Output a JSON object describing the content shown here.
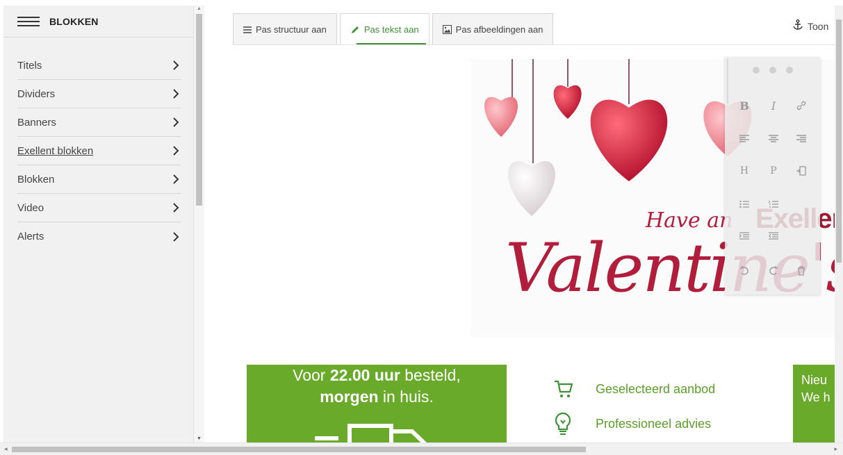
{
  "sidebar": {
    "title": "BLOKKEN",
    "items": [
      {
        "label": "Titels"
      },
      {
        "label": "Dividers"
      },
      {
        "label": "Banners"
      },
      {
        "label": "Exellent blokken"
      },
      {
        "label": "Blokken"
      },
      {
        "label": "Video"
      },
      {
        "label": "Alerts"
      }
    ]
  },
  "tabs": [
    {
      "label": "Pas structuur aan",
      "icon": "list-icon"
    },
    {
      "label": "Pas tekst aan",
      "icon": "pencil-icon",
      "active": true
    },
    {
      "label": "Pas afbeeldingen aan",
      "icon": "image-icon"
    }
  ],
  "toon": {
    "label": "Toon",
    "icon": "anchor-icon"
  },
  "banner": {
    "have": "Have an",
    "brand": "Exeller",
    "valentine": "Valentine's"
  },
  "editor_toolbar": {
    "bold": "B",
    "italic": "I",
    "heading": "H",
    "paragraph": "P"
  },
  "promo": {
    "line1_pre": "Voor ",
    "line1_bold": "22.00 uur",
    "line1_post": " besteld,",
    "line2_bold": "morgen",
    "line2_post": " in huis."
  },
  "features": [
    {
      "label": "Geselecteerd aanbod",
      "icon": "cart-icon"
    },
    {
      "label": "Professioneel advies",
      "icon": "lightbulb-icon"
    }
  ],
  "right_promo": {
    "line1": "Nieu",
    "line2": "We h"
  },
  "colors": {
    "accent": "#3f8f36",
    "promo_green": "#6aaa2a",
    "valentine_red": "#b01e3c"
  }
}
